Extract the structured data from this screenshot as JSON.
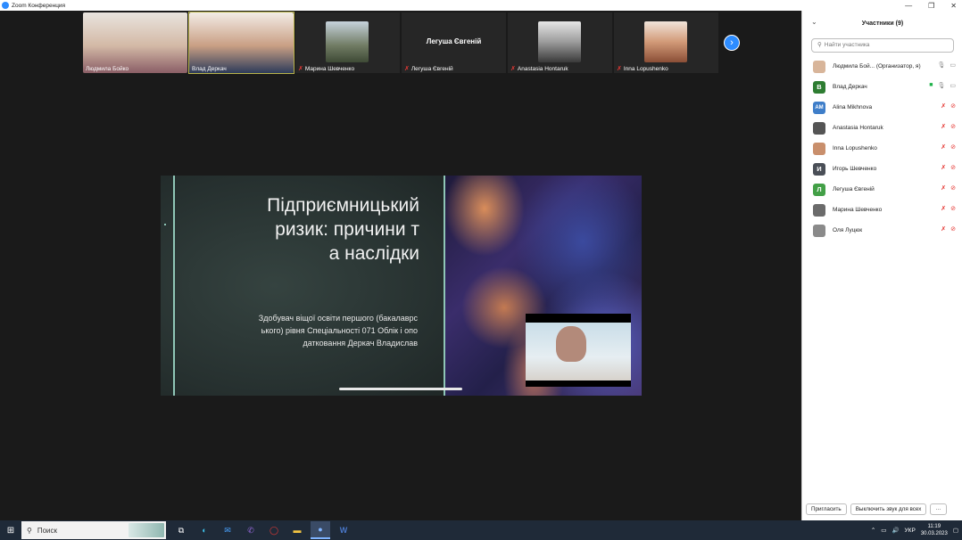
{
  "window": {
    "title": "Zoom Конференция",
    "controls": [
      "—",
      "❐",
      "✕"
    ]
  },
  "thumbnails": [
    {
      "name": "Людмила Бойко",
      "muted": false,
      "video": true,
      "color": "#d8c7b5"
    },
    {
      "name": "Влад Деркач",
      "muted": false,
      "video": true,
      "active": true,
      "color": "#c9a58b"
    },
    {
      "name": "Марина Шевченко",
      "muted": true,
      "video": true,
      "color": "#7a8b6a"
    },
    {
      "name": "Легуша Євгеній",
      "center_name": "Легуша Євгеній",
      "muted": true,
      "video": false
    },
    {
      "name": "Anastasia Hontaruk",
      "muted": true,
      "video": true,
      "color": "#bdbdbd"
    },
    {
      "name": "Inna Lopushenko",
      "muted": true,
      "video": true,
      "color": "#c98f6c"
    }
  ],
  "next_icon": "chevron-right-icon",
  "slide": {
    "title_lines": [
      "Підприємницький",
      "ризик: причини т",
      "а наслідки"
    ],
    "subtitle_lines": [
      "Здобувач віщої освіти першого (бакалаврс",
      "ького) рівня Спеціальності 071 Облік і опо",
      "датковання Деркач Владислав"
    ]
  },
  "panel": {
    "title": "Участники (9)",
    "search_placeholder": "Найти участника",
    "participants": [
      {
        "name": "Людмила Бой...  (Организатор, я)",
        "avatar_type": "photo",
        "avatar_color": "#d8b59a",
        "mic": "on",
        "cam": "on"
      },
      {
        "name": "Влад Деркач",
        "avatar_letter": "В",
        "avatar_color": "#2e7d32",
        "mic": "on",
        "cam": "on-green"
      },
      {
        "name": "Alina Mikhnova",
        "avatar_letter": "AM",
        "avatar_color": "#3f7ec9",
        "mic": "off",
        "cam": "off"
      },
      {
        "name": "Anastasia Hontaruk",
        "avatar_type": "photo",
        "avatar_color": "#555555",
        "mic": "off",
        "cam": "off"
      },
      {
        "name": "Inna Lopushenko",
        "avatar_type": "photo",
        "avatar_color": "#c98f6c",
        "mic": "off",
        "cam": "off"
      },
      {
        "name": "Игорь Шевченко",
        "avatar_letter": "И",
        "avatar_color": "#4a4f57",
        "mic": "off",
        "cam": "off"
      },
      {
        "name": "Легуша Євгеній",
        "avatar_letter": "Л",
        "avatar_color": "#43a047",
        "mic": "off",
        "cam": "off"
      },
      {
        "name": "Марина Шевченко",
        "avatar_type": "photo",
        "avatar_color": "#6b6b6b",
        "mic": "off",
        "cam": "off"
      },
      {
        "name": "Оля Луцюк",
        "avatar_type": "photo",
        "avatar_color": "#8a8a8a",
        "mic": "off",
        "cam": "off"
      }
    ],
    "invite_label": "Пригласить",
    "mute_all_label": "Выключить звук для всех",
    "more_label": "···"
  },
  "taskbar": {
    "search_label": "Поиск",
    "language": "УКР",
    "time": "11:19",
    "date": "30.03.2023"
  }
}
